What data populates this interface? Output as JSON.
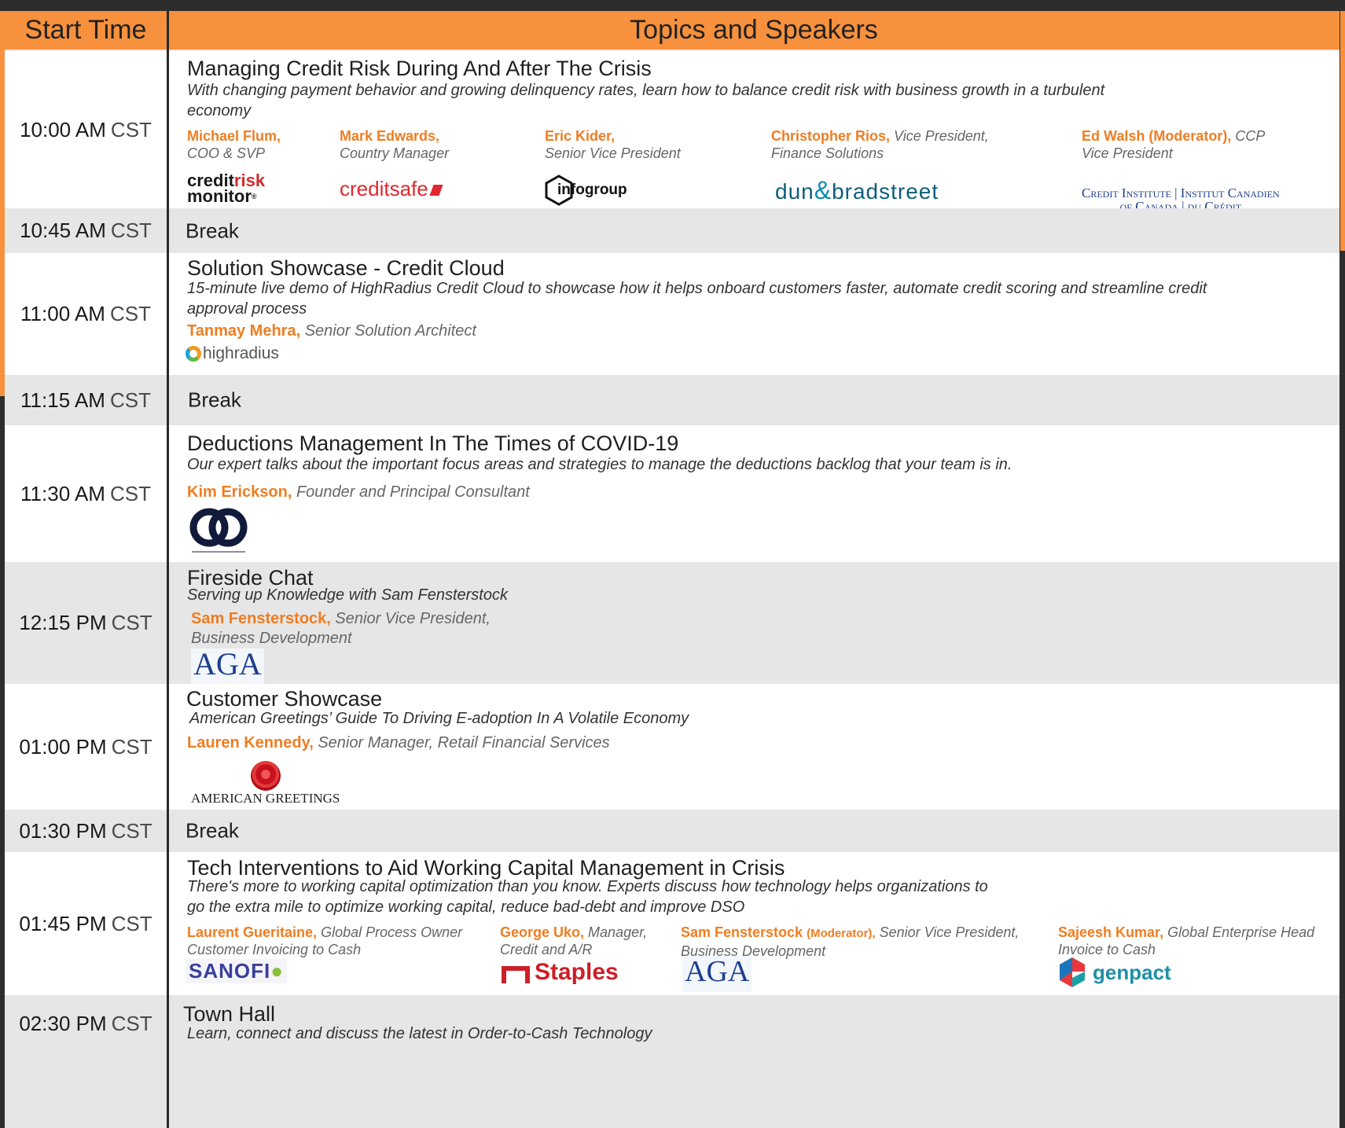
{
  "header": {
    "start_time": "Start Time",
    "topics": "Topics and Speakers"
  },
  "colors": {
    "accent": "#f7913d",
    "speaker_name": "#ef7d21",
    "break_bg": "#e6e6e6"
  },
  "sessions": [
    {
      "time": "10:00 AM",
      "tz": "CST",
      "title": "Managing Credit Risk During And After The Crisis",
      "desc": "With changing payment behavior and growing delinquency rates, learn how to balance credit risk with business growth in a turbulent economy",
      "speakers": [
        {
          "name": "Michael Flum,",
          "role": "COO & SVP"
        },
        {
          "name": "Mark Edwards,",
          "role": "Country Manager"
        },
        {
          "name": "Eric Kider,",
          "role": "Senior Vice President"
        },
        {
          "name": "Christopher Rios,",
          "role_inline": "Vice President,",
          "role": "Finance Solutions"
        },
        {
          "name": "Ed Walsh (Moderator),",
          "role_inline": "CCP",
          "role": "Vice President"
        }
      ],
      "logos": {
        "crm_a": "credit",
        "crm_b": "risk",
        "crm_c": "monitor",
        "crm_tm": "®",
        "creditsafe": "creditsafe",
        "infogroup": "infogroup",
        "db_a": "dun",
        "db_amp": "&",
        "db_b": "bradstreet",
        "ci_1": "Credit Institute | Institut Canadien",
        "ci_2": "of Canada | du Crédit"
      }
    },
    {
      "time": "10:45 AM",
      "tz": "CST",
      "break": "Break"
    },
    {
      "time": "11:00 AM",
      "tz": "CST",
      "title": "Solution Showcase - Credit Cloud",
      "desc": "15-minute live demo of HighRadius Credit Cloud to showcase how it helps onboard customers faster, automate credit scoring and streamline credit approval process",
      "speakers": [
        {
          "name": "Tanmay Mehra,",
          "role": "Senior Solution Architect"
        }
      ],
      "logos": {
        "highradius": "highradius"
      }
    },
    {
      "time": "11:15 AM",
      "tz": "CST",
      "break": "Break"
    },
    {
      "time": "11:30 AM",
      "tz": "CST",
      "title": "Deductions Management In The Times of COVID-19",
      "desc": "Our expert talks about the important focus areas and strategies to manage the deductions backlog that your team is in.",
      "speakers": [
        {
          "name": "Kim Erickson,",
          "role": "Founder and Principal Consultant"
        }
      ]
    },
    {
      "time": "12:15 PM",
      "tz": "CST",
      "title": "Fireside Chat",
      "desc": "Serving up Knowledge with Sam Fensterstock",
      "speakers": [
        {
          "name": "Sam Fensterstock,",
          "role_inline": "Senior Vice President,",
          "role": "Business Development"
        }
      ],
      "logos": {
        "aga": "AGA"
      }
    },
    {
      "time": "01:00 PM",
      "tz": "CST",
      "title": "Customer Showcase",
      "desc": "American Greetings’ Guide To Driving E-adoption In A Volatile Economy",
      "speakers": [
        {
          "name": "Lauren Kennedy,",
          "role": "Senior Manager, Retail Financial Services"
        }
      ],
      "logos": {
        "ag": "AMERICAN GREETINGS"
      }
    },
    {
      "time": "01:30 PM",
      "tz": "CST",
      "break": "Break"
    },
    {
      "time": "01:45 PM",
      "tz": "CST",
      "title": "Tech Interventions to Aid Working Capital Management in Crisis",
      "desc": "There's more to working capital optimization than you know. Experts discuss how technology helps organizations to go the extra mile to optimize working capital, reduce bad-debt and improve DSO",
      "speakers": [
        {
          "name": "Laurent Gueritaine,",
          "role_inline": "Global Process Owner",
          "role": "Customer Invoicing to Cash"
        },
        {
          "name": "George Uko,",
          "role_inline": "Manager,",
          "role": "Credit and A/R"
        },
        {
          "name": "Sam Fensterstock",
          "name_small": "(Moderator),",
          "role_inline": "Senior Vice President,",
          "role": "Business Development"
        },
        {
          "name": "Sajeesh Kumar,",
          "role_inline": "Global Enterprise Head",
          "role": "Invoice to Cash"
        }
      ],
      "logos": {
        "sanofi": "SANOFI",
        "staples": "Staples",
        "aga": "AGA",
        "genpact": "genpact"
      }
    },
    {
      "time": "02:30 PM",
      "tz": "CST",
      "title": "Town Hall",
      "desc": "Learn, connect and discuss the latest in Order-to-Cash Technology"
    }
  ]
}
